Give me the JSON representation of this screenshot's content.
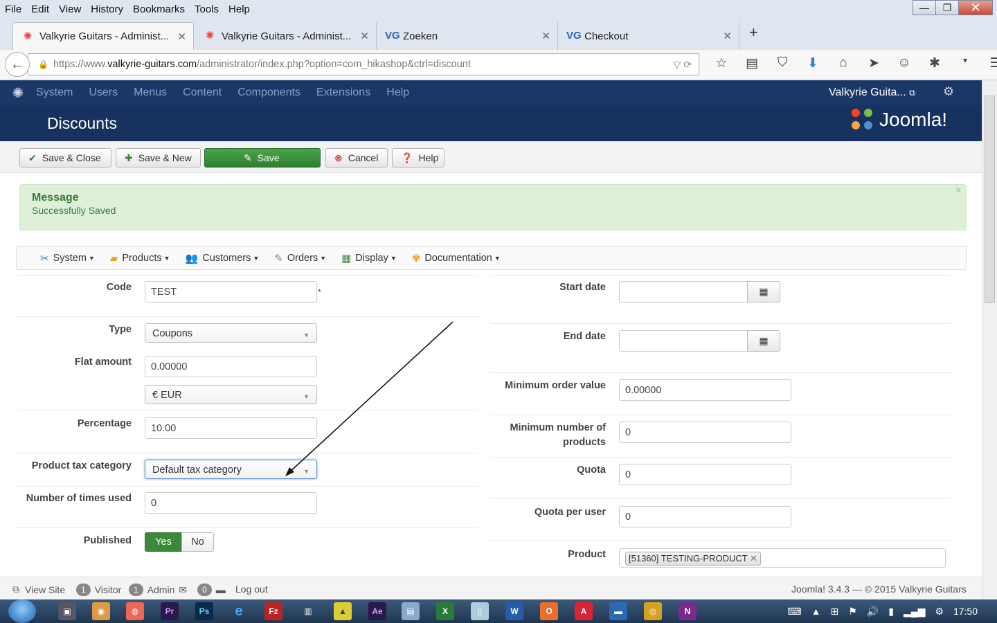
{
  "browser": {
    "menu": [
      "File",
      "Edit",
      "View",
      "History",
      "Bookmarks",
      "Tools",
      "Help"
    ],
    "window_buttons": {
      "minimize": "—",
      "maximize": "❐",
      "close": "✕"
    },
    "tabs": [
      {
        "label": "Valkyrie Guitars - Administ...",
        "icon": "joomla-icon",
        "active": true
      },
      {
        "label": "Valkyrie Guitars - Administ...",
        "icon": "joomla-icon",
        "active": false
      },
      {
        "label": "Zoeken",
        "icon": "vg-icon",
        "active": false
      },
      {
        "label": "Checkout",
        "icon": "vg-icon",
        "active": false
      }
    ],
    "new_tab_label": "+",
    "url": {
      "prefix": "https://www.",
      "host": "valkyrie-guitars.com",
      "path": "/administrator/index.php?option=com_hikashop&ctrl=discount"
    }
  },
  "joomla": {
    "nav": [
      "System",
      "Users",
      "Menus",
      "Content",
      "Components",
      "Extensions",
      "Help"
    ],
    "site_name": "Valkyrie Guita...",
    "page_title": "Discounts",
    "brand": "Joomla!",
    "toolbar": {
      "save_close": "Save & Close",
      "save_new": "Save & New",
      "save": "Save",
      "cancel": "Cancel",
      "help": "Help"
    },
    "message": {
      "heading": "Message",
      "text": "Successfully Saved",
      "close": "×"
    }
  },
  "hikashop_menu": [
    {
      "label": "System",
      "icon": "tools-icon"
    },
    {
      "label": "Products",
      "icon": "box-icon"
    },
    {
      "label": "Customers",
      "icon": "users-icon"
    },
    {
      "label": "Orders",
      "icon": "cart-icon"
    },
    {
      "label": "Display",
      "icon": "display-icon"
    },
    {
      "label": "Documentation",
      "icon": "help-icon"
    }
  ],
  "form": {
    "left": {
      "code": {
        "label": "Code",
        "value": "TEST",
        "required_mark": "*"
      },
      "type": {
        "label": "Type",
        "value": "Coupons"
      },
      "flat_amount": {
        "label": "Flat amount",
        "value": "0.00000",
        "currency": "€ EUR"
      },
      "percentage": {
        "label": "Percentage",
        "value": "10.00"
      },
      "tax_category": {
        "label": "Product tax category",
        "value": "Default tax category"
      },
      "times_used": {
        "label": "Number of times used",
        "value": "0"
      },
      "published": {
        "label": "Published",
        "yes": "Yes",
        "no": "No",
        "selected": "Yes"
      }
    },
    "right": {
      "start_date": {
        "label": "Start date",
        "value": ""
      },
      "end_date": {
        "label": "End date",
        "value": ""
      },
      "min_order": {
        "label": "Minimum order value",
        "value": "0.00000"
      },
      "min_products": {
        "label_line1": "Minimum number of",
        "label_line2": "products",
        "value": "0"
      },
      "quota": {
        "label": "Quota",
        "value": "0"
      },
      "quota_user": {
        "label": "Quota per user",
        "value": "0"
      },
      "product": {
        "label": "Product",
        "tag": "[51360] TESTING-PRODUCT"
      }
    }
  },
  "status": {
    "view_site": "View Site",
    "visitor_count": "1",
    "visitor_label": "Visitor",
    "admin_count": "1",
    "admin_label": "Admin",
    "msg_count": "0",
    "logout": "Log out",
    "version": "Joomla! 3.4.3",
    "copyright": "— © 2015 Valkyrie Guitars"
  },
  "taskbar": {
    "clock": "17:50"
  },
  "colors": {
    "joomla_nav": "#1a3867",
    "joomla_header": "#17325f",
    "save_green": "#3a8a3a",
    "message_bg": "#dff0d8"
  }
}
